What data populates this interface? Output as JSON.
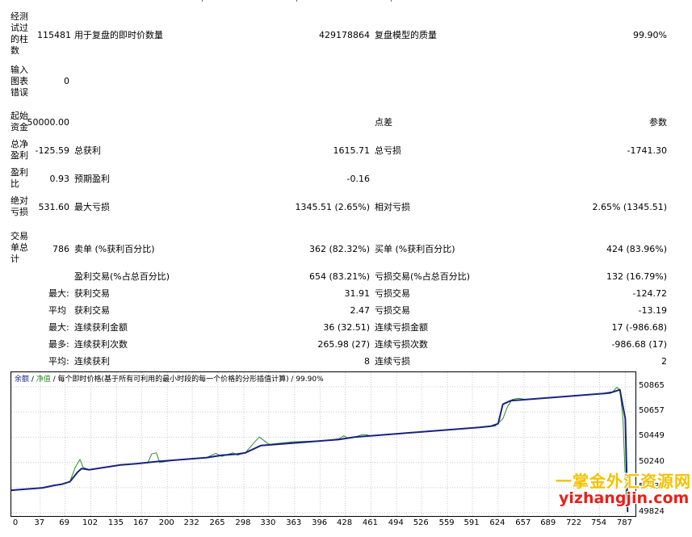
{
  "report": {
    "bars_label": "经测试过的柱数",
    "bars_value": "115481",
    "ticks_label": "用于复盘的即时价数量",
    "ticks_value": "429178864",
    "quality_label": "复盘模型的质量",
    "quality_value": "99.90%",
    "mismatch_label": "输入图表错误",
    "mismatch_value": "0",
    "deposit_label": "起始资金",
    "deposit_value": "50000.00",
    "spread_label": "点差",
    "spread_value": "参数",
    "net_profit_label": "总净盈利",
    "net_profit_value": "-125.59",
    "gross_profit_label": "总获利",
    "gross_profit_value": "1615.71",
    "gross_loss_label": "总亏损",
    "gross_loss_value": "-1741.30",
    "profit_factor_label": "盈利比",
    "profit_factor_value": "0.93",
    "expected_payoff_label": "预期盈利",
    "expected_payoff_value": "-0.16",
    "abs_drawdown_label": "绝对亏损",
    "abs_drawdown_value": "531.60",
    "max_drawdown_label": "最大亏损",
    "max_drawdown_value": "1345.51 (2.65%)",
    "rel_drawdown_label": "相对亏损",
    "rel_drawdown_value": "2.65% (1345.51)",
    "total_trades_label": "交易单总计",
    "total_trades_value": "786",
    "short_label": "卖单 (%获利百分比)",
    "short_value": "362 (82.32%)",
    "long_label": "买单 (%获利百分比)",
    "long_value": "424 (83.96%)",
    "profit_trades_label": "盈利交易(%占总百分比)",
    "profit_trades_value": "654 (83.21%)",
    "loss_trades_label": "亏损交易(%占总百分比)",
    "loss_trades_value": "132 (16.79%)",
    "largest_prefix": "最大:",
    "largest_profit_label": "获利交易",
    "largest_profit_value": "31.91",
    "largest_loss_label": "亏损交易",
    "largest_loss_value": "-124.72",
    "average_prefix": "平均",
    "average_profit_label": "获利交易",
    "average_profit_value": "2.47",
    "average_loss_label": "亏损交易",
    "average_loss_value": "-13.19",
    "max_prefix": "最大:",
    "max_cons_wins_label": "连续获利金额",
    "max_cons_wins_value": "36 (32.51)",
    "max_cons_losses_label": "连续亏损金额",
    "max_cons_losses_value": "17 (-986.68)",
    "maximal_prefix": "最多:",
    "maximal_cons_profit_label": "连续获利次数",
    "maximal_cons_profit_value": "265.98 (27)",
    "maximal_cons_loss_label": "连续亏损次数",
    "maximal_cons_loss_value": "-986.68 (17)",
    "avg_prefix": "平均:",
    "avg_cons_wins_label": "连续获利",
    "avg_cons_wins_value": "8",
    "avg_cons_losses_label": "连续亏损",
    "avg_cons_losses_value": "2"
  },
  "chart": {
    "legend_balance": "余额",
    "legend_sep1": " / ",
    "legend_equity": "净值",
    "legend_rest": " / 每个即时价格(基于所有可利用的最小时段的每一个价格的分形插值计算) / 99.90%",
    "balance_color": "#1a237e",
    "equity_color": "#2e8b2e"
  },
  "chart_data": {
    "type": "line",
    "x_ticks": [
      "0",
      "37",
      "69",
      "102",
      "135",
      "167",
      "200",
      "232",
      "265",
      "298",
      "330",
      "363",
      "396",
      "428",
      "461",
      "494",
      "526",
      "559",
      "591",
      "624",
      "657",
      "689",
      "722",
      "754",
      "787"
    ],
    "y_ticks": [
      "50865",
      "50657",
      "50449",
      "50240",
      "50032",
      "49824"
    ],
    "ylim": [
      49824,
      50865
    ],
    "xlim": [
      0,
      800
    ],
    "series": [
      {
        "name": "余额",
        "x": [
          0,
          20,
          40,
          55,
          65,
          75,
          85,
          90,
          100,
          120,
          140,
          160,
          175,
          190,
          210,
          230,
          250,
          270,
          290,
          300,
          320,
          340,
          360,
          380,
          400,
          420,
          440,
          460,
          480,
          500,
          520,
          540,
          560,
          580,
          600,
          615,
          624,
          630,
          640,
          660,
          680,
          700,
          720,
          740,
          760,
          770,
          780,
          787,
          790
        ],
        "y": [
          50010,
          50020,
          50030,
          50050,
          50060,
          50080,
          50160,
          50190,
          50180,
          50200,
          50220,
          50230,
          50240,
          50250,
          50260,
          50270,
          50280,
          50300,
          50310,
          50320,
          50380,
          50390,
          50400,
          50410,
          50420,
          50430,
          50450,
          50460,
          50470,
          50480,
          50490,
          50500,
          50510,
          50520,
          50530,
          50540,
          50560,
          50720,
          50750,
          50760,
          50770,
          50780,
          50790,
          50800,
          50810,
          50820,
          50840,
          50600,
          49830
        ]
      },
      {
        "name": "净值",
        "x": [
          0,
          20,
          40,
          55,
          65,
          75,
          82,
          88,
          92,
          100,
          120,
          140,
          160,
          175,
          180,
          186,
          190,
          210,
          230,
          250,
          262,
          270,
          284,
          290,
          300,
          312,
          318,
          330,
          360,
          400,
          420,
          426,
          432,
          440,
          450,
          455,
          460,
          480,
          520,
          560,
          600,
          620,
          630,
          636,
          642,
          650,
          660,
          700,
          740,
          768,
          772,
          776,
          780,
          784,
          787,
          790
        ],
        "y": [
          50010,
          50020,
          50030,
          50050,
          50060,
          50080,
          50200,
          50265,
          50200,
          50180,
          50200,
          50220,
          50230,
          50240,
          50310,
          50320,
          50240,
          50260,
          50270,
          50280,
          50315,
          50290,
          50320,
          50300,
          50320,
          50410,
          50450,
          50390,
          50410,
          50420,
          50435,
          50460,
          50440,
          50450,
          50470,
          50470,
          50460,
          50470,
          50490,
          50510,
          50530,
          50540,
          50600,
          50700,
          50760,
          50770,
          50760,
          50780,
          50800,
          50810,
          50830,
          50860,
          50840,
          50600,
          50100,
          49830
        ]
      }
    ]
  },
  "watermark": {
    "line1": "一掌金外汇资源网",
    "line2": "yizhangjin.com"
  }
}
